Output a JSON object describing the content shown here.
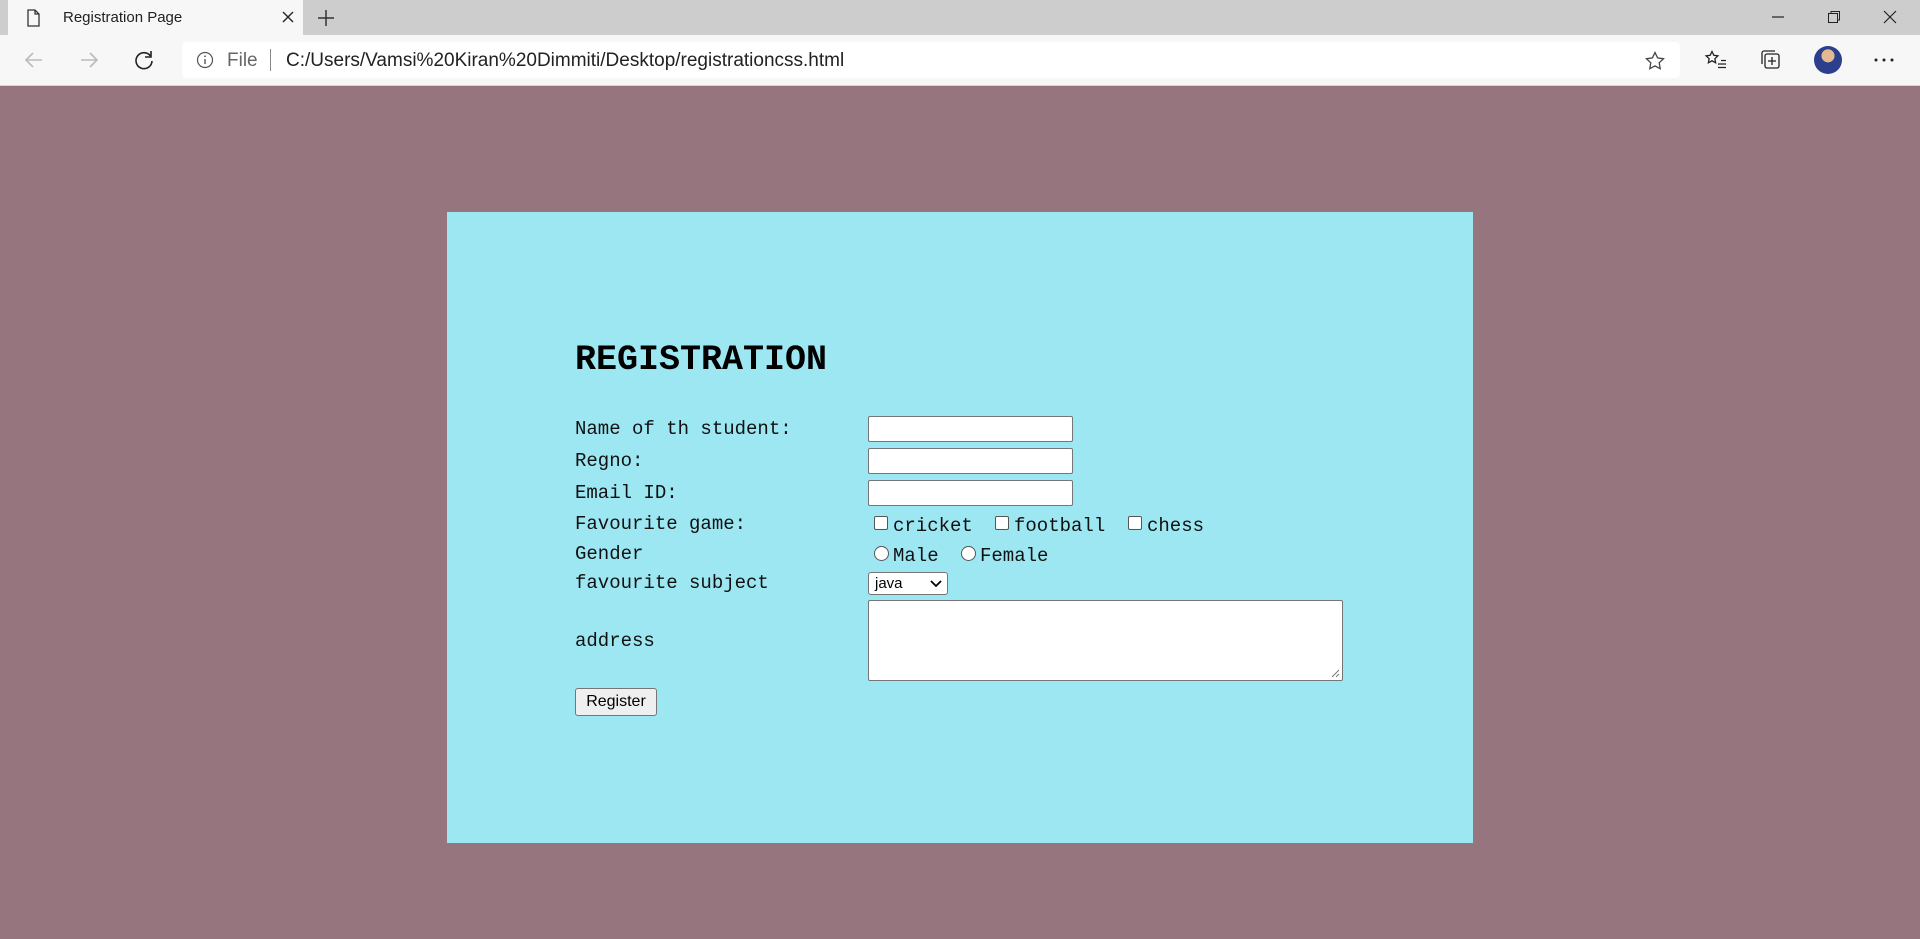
{
  "browser": {
    "tab_title": "Registration Page",
    "address": {
      "scheme": "File",
      "url": "C:/Users/Vamsi%20Kiran%20Dimmiti/Desktop/registrationcss.html"
    }
  },
  "page": {
    "background_color": "#97757e",
    "panel_color": "#9ce7f2",
    "form": {
      "title": "REGISTRATION",
      "name_label": "Name of th student:",
      "name_value": "",
      "regno_label": "Regno:",
      "regno_value": "",
      "email_label": "Email ID:",
      "email_value": "",
      "game_label": "Favourite game:",
      "games": [
        "cricket",
        "football",
        "chess"
      ],
      "gender_label": "Gender",
      "genders": [
        "Male",
        "Female"
      ],
      "subject_label": "favourite subject",
      "subject_selected": "java",
      "address_label": "address",
      "address_value": "",
      "register_label": "Register"
    }
  }
}
